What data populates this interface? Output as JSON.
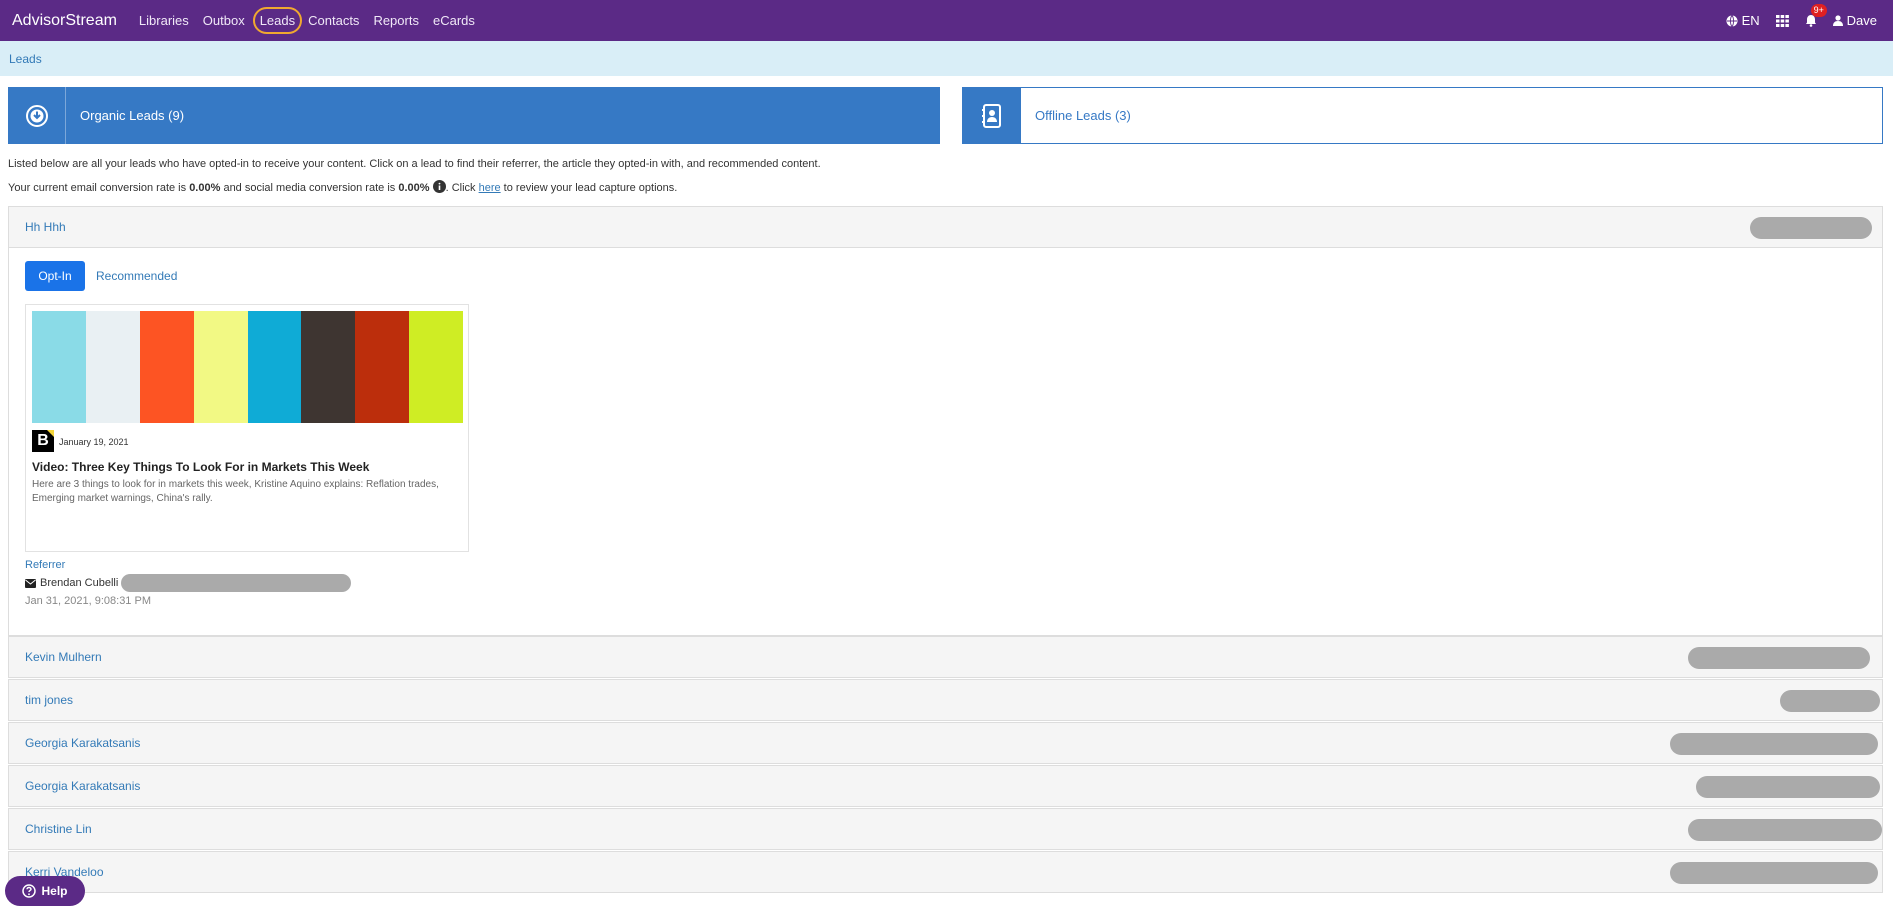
{
  "navbar": {
    "brand": "AdvisorStream",
    "links": [
      "Libraries",
      "Outbox",
      "Leads",
      "Contacts",
      "Reports",
      "eCards"
    ],
    "language": "EN",
    "notifications_badge": "9+",
    "user": "Dave",
    "background": "#5b2a86"
  },
  "breadcrumb": "Leads",
  "tiles": {
    "organic": "Organic Leads (9)",
    "offline": "Offline Leads (3)"
  },
  "description": {
    "line1": "Listed below are all your leads who have opted-in to receive your content. Click on a lead to find their referrer, the article they opted-in with, and recommended content.",
    "line2_prefix": "Your current email conversion rate is ",
    "email_rate": "0.00%",
    "line2_mid": " and social media conversion rate is ",
    "social_rate": "0.00%",
    "line2_click": ". Click ",
    "here": "here",
    "line2_suffix": " to review your lead capture options."
  },
  "expanded_lead": {
    "name": "Hh Hhh",
    "tabs": [
      "Opt-In",
      "Recommended"
    ],
    "article": {
      "swatches": [
        "#8adbe7",
        "#e9f0f3",
        "#fd5423",
        "#f2f984",
        "#0fabd6",
        "#3e3531",
        "#bc2e0c",
        "#cfed24"
      ],
      "logo_letter": "B",
      "date": "January 19, 2021",
      "title": "Video: Three Key Things To Look For in Markets This Week",
      "summary": "Here are 3 things to look for in markets this week, Kristine Aquino explains: Reflation trades, Emerging market warnings, China's rally."
    },
    "referrer_label": "Referrer",
    "referrer_name": "Brendan Cubelli",
    "referred_at": "Jan 31, 2021, 9:08:31 PM"
  },
  "leads": [
    {
      "name": "Kevin Mulhern"
    },
    {
      "name": "tim jones"
    },
    {
      "name": "Georgia Karakatsanis"
    },
    {
      "name": "Georgia Karakatsanis"
    },
    {
      "name": "Christine Lin"
    },
    {
      "name": "Kerri Vandeloo"
    }
  ],
  "help": "Help"
}
